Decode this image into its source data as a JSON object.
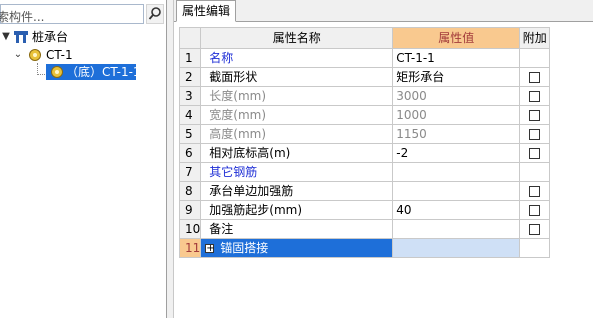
{
  "search": {
    "placeholder": "索构件..."
  },
  "tree": {
    "root": {
      "label": "桩承台",
      "expanded": "▼"
    },
    "child": {
      "label": "CT-1",
      "expanded": "⌄"
    },
    "leaf": {
      "label": "（底）CT-1-1"
    }
  },
  "tab": {
    "label": "属性编辑"
  },
  "grid": {
    "headers": {
      "name": "属性名称",
      "value": "属性值",
      "extra": "附加"
    },
    "rows": [
      {
        "num": "1",
        "name": "名称",
        "value": "CT-1-1",
        "checkbox": false,
        "style": "blue"
      },
      {
        "num": "2",
        "name": "截面形状",
        "value": "矩形承台",
        "checkbox": true,
        "style": "normal"
      },
      {
        "num": "3",
        "name": "长度(mm)",
        "value": "3000",
        "checkbox": true,
        "style": "gray"
      },
      {
        "num": "4",
        "name": "宽度(mm)",
        "value": "1000",
        "checkbox": true,
        "style": "gray"
      },
      {
        "num": "5",
        "name": "高度(mm)",
        "value": "1150",
        "checkbox": true,
        "style": "gray"
      },
      {
        "num": "6",
        "name": "相对底标高(m)",
        "value": "-2",
        "checkbox": true,
        "style": "normal"
      },
      {
        "num": "7",
        "name": "其它钢筋",
        "value": "",
        "checkbox": false,
        "style": "blue"
      },
      {
        "num": "8",
        "name": "承台单边加强筋",
        "value": "",
        "checkbox": true,
        "style": "normal"
      },
      {
        "num": "9",
        "name": "加强筋起步(mm)",
        "value": "40",
        "checkbox": true,
        "style": "normal"
      },
      {
        "num": "10",
        "name": "备注",
        "value": "",
        "checkbox": true,
        "style": "normal"
      },
      {
        "num": "11",
        "name": "锚固搭接",
        "value": "",
        "checkbox": false,
        "style": "selected",
        "expander": "+"
      }
    ]
  },
  "colors": {
    "selection": "#1e6fd9",
    "header_accent": "#f9c98f",
    "link_blue": "#1f2fd6"
  }
}
